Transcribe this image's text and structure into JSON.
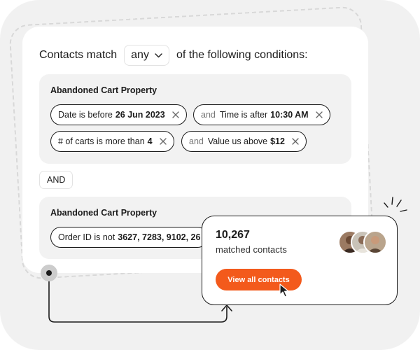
{
  "header": {
    "prefix": "Contacts match",
    "select_value": "any",
    "suffix": "of the following conditions:"
  },
  "groups": [
    {
      "title": "Abandoned Cart Property",
      "conditions": [
        {
          "connector": "",
          "text": "Date is before",
          "value": "26 Jun 2023"
        },
        {
          "connector": "and",
          "text": "Time is after",
          "value": "10:30 AM"
        },
        {
          "connector": "",
          "text": "# of carts is more than",
          "value": "4"
        },
        {
          "connector": "and",
          "text": "Value us above",
          "value": "$12"
        }
      ]
    },
    {
      "title": "Abandoned Cart Property",
      "conditions": [
        {
          "connector": "",
          "text": "Order ID is not",
          "value": "3627, 7283, 9102, 26"
        }
      ]
    }
  ],
  "group_joiner": "AND",
  "result": {
    "count": "10,267",
    "label": "matched contacts",
    "button_label": "View all contacts"
  },
  "colors": {
    "accent": "#f35a1c",
    "ink": "#1c1c1c",
    "panel": "#f2f2f2",
    "backdrop": "#f1f1f1"
  },
  "icons": [
    "chevron-down-icon",
    "close-icon",
    "person-icon",
    "cursor-arrow-icon",
    "sparkle-icon",
    "connector-arrow-icon"
  ]
}
